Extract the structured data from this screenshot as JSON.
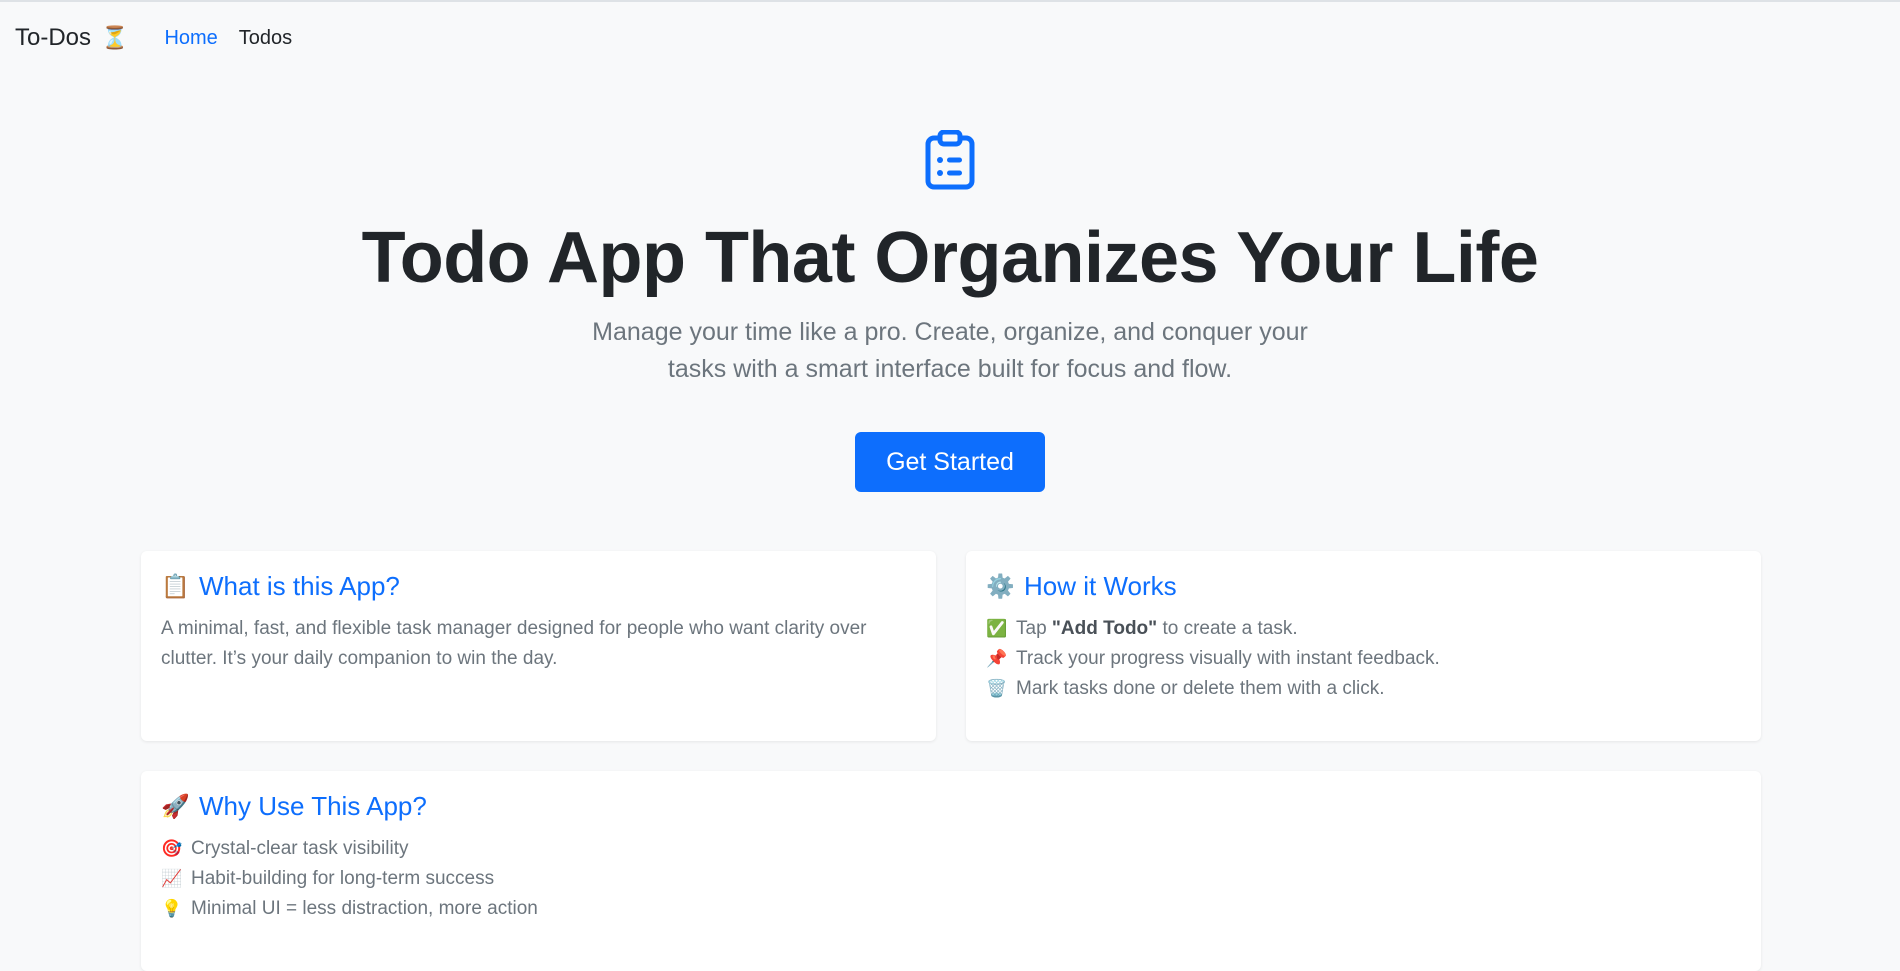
{
  "nav": {
    "brand": "To-Dos",
    "brand_emoji": "⏳",
    "links": [
      {
        "label": "Home",
        "active": true
      },
      {
        "label": "Todos",
        "active": false
      }
    ]
  },
  "hero": {
    "icon": "clipboard-list-icon",
    "title": "Todo App That Organizes Your Life",
    "subtitle": "Manage your time like a pro. Create, organize, and conquer your tasks with a smart interface built for focus and flow.",
    "cta_label": "Get Started"
  },
  "cards": {
    "what": {
      "emoji": "📋",
      "title": "What is this App?",
      "text": "A minimal, fast, and flexible task manager designed for people who want clarity over clutter. It’s your daily companion to win the day."
    },
    "how": {
      "emoji": "⚙️",
      "title": "How it Works",
      "items": [
        {
          "emoji": "✅",
          "pre": "Tap ",
          "bold": "\"Add Todo\"",
          "post": " to create a task."
        },
        {
          "emoji": "📌",
          "text": "Track your progress visually with instant feedback."
        },
        {
          "emoji": "🗑️",
          "text": "Mark tasks done or delete them with a click."
        }
      ]
    },
    "why": {
      "emoji": "🚀",
      "title": "Why Use This App?",
      "items": [
        {
          "emoji": "🎯",
          "text": "Crystal-clear task visibility"
        },
        {
          "emoji": "📈",
          "text": "Habit-building for long-term success"
        },
        {
          "emoji": "💡",
          "text": "Minimal UI = less distraction, more action"
        }
      ]
    }
  },
  "colors": {
    "accent": "#0d6efd",
    "background": "#f8f9fa",
    "muted_text": "#6c757d"
  }
}
